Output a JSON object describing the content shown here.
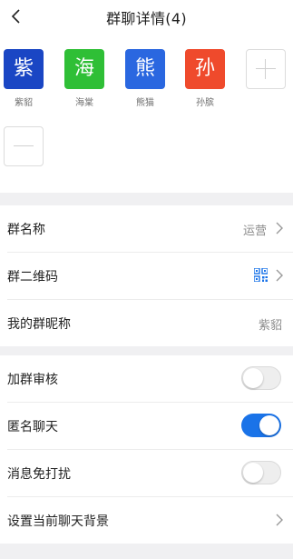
{
  "header": {
    "title": "群聊详情(4)"
  },
  "members": [
    {
      "name": "紫貂",
      "glyph": "紫",
      "color": "#1a46c4"
    },
    {
      "name": "海棠",
      "glyph": "海",
      "color": "#2fbf36"
    },
    {
      "name": "熊猫",
      "glyph": "熊",
      "color": "#2a67e0"
    },
    {
      "name": "孙膑",
      "glyph": "孙",
      "color": "#ef4a2c"
    }
  ],
  "settings": {
    "group_name": {
      "label": "群名称",
      "value": "运营"
    },
    "qr_code": {
      "label": "群二维码"
    },
    "my_nickname": {
      "label": "我的群昵称",
      "value": "紫貂"
    },
    "join_review": {
      "label": "加群审核",
      "enabled": false
    },
    "anonymous_chat": {
      "label": "匿名聊天",
      "enabled": true
    },
    "mute": {
      "label": "消息免打扰",
      "enabled": false
    },
    "chat_background": {
      "label": "设置当前聊天背景"
    }
  },
  "colors": {
    "accent": "#1a73e8",
    "page_gap": "#f0f0f2"
  },
  "icons": {
    "back": "chevron-left-icon",
    "arrow": "chevron-right-icon",
    "qr": "qr-code-icon",
    "add": "plus-icon",
    "remove": "minus-icon"
  }
}
